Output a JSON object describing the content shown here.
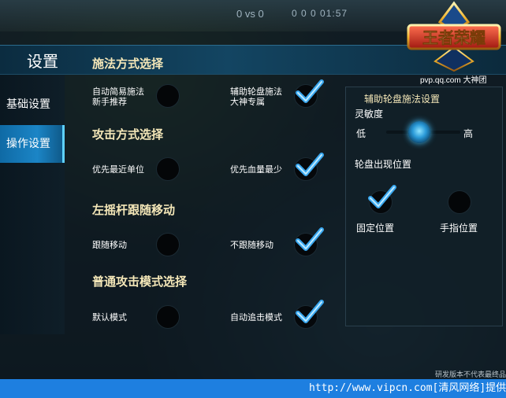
{
  "top_hud": {
    "score_text": "0 vs 0",
    "stats_text": "0   0   0   01:57"
  },
  "header": {
    "title": "设置"
  },
  "logo": {
    "text": "王者荣耀",
    "site": "pvp.qq.com 大神团"
  },
  "sidebar": {
    "items": [
      {
        "label": "基础设置",
        "active": false
      },
      {
        "label": "操作设置",
        "active": true
      }
    ]
  },
  "sections": [
    {
      "title": "施法方式选择",
      "left": {
        "label_line1": "自动简易施法",
        "label_line2": "新手推荐",
        "checked": false
      },
      "right": {
        "label_line1": "辅助轮盘施法",
        "label_line2": "大神专属",
        "checked": true
      }
    },
    {
      "title": "攻击方式选择",
      "left": {
        "label_line1": "优先最近单位",
        "label_line2": "",
        "checked": false
      },
      "right": {
        "label_line1": "优先血量最少",
        "label_line2": "",
        "checked": true
      }
    },
    {
      "title": "左摇杆跟随移动",
      "left": {
        "label_line1": "跟随移动",
        "label_line2": "",
        "checked": false
      },
      "right": {
        "label_line1": "不跟随移动",
        "label_line2": "",
        "checked": true
      }
    },
    {
      "title": "普通攻击模式选择",
      "left": {
        "label_line1": "默认模式",
        "label_line2": "",
        "checked": false
      },
      "right": {
        "label_line1": "自动追击模式",
        "label_line2": "",
        "checked": true
      }
    }
  ],
  "wheel_panel": {
    "title": "辅助轮盘施法设置",
    "sensitivity_label": "灵敏度",
    "low_label": "低",
    "high_label": "高",
    "sensitivity_value": 0.45,
    "position_title": "轮盘出现位置",
    "fixed_label": "固定位置",
    "fixed_checked": true,
    "finger_label": "手指位置",
    "finger_checked": false
  },
  "footer_note": "研发版本不代表最终品质",
  "watermark": "http://www.vipcn.com[清风网络]提供",
  "colors": {
    "accent_blue": "#1b85c6",
    "check_blue": "#3aa8f0",
    "section_title": "#f4e7b8",
    "watermark_bar": "#1e7fe0"
  }
}
